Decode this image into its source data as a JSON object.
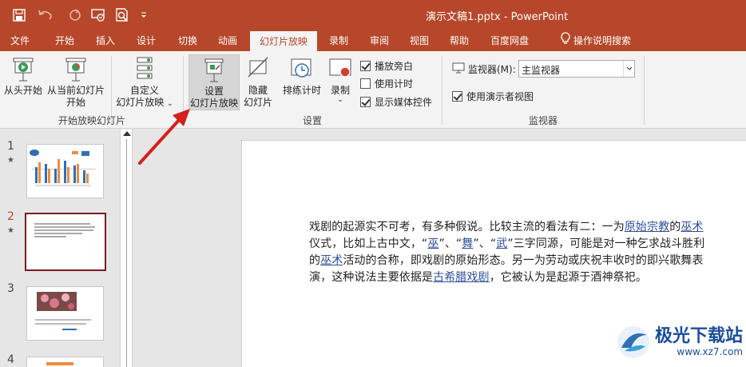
{
  "window": {
    "title": "演示文稿1.pptx  -  PowerPoint"
  },
  "qat": [
    {
      "name": "save-icon"
    },
    {
      "name": "undo-icon"
    },
    {
      "name": "redo-icon"
    },
    {
      "name": "presenter-icon"
    },
    {
      "name": "print-preview-icon"
    },
    {
      "name": "customize-qat-icon"
    }
  ],
  "tabs": [
    "文件",
    "开始",
    "插入",
    "设计",
    "切换",
    "动画",
    "幻灯片放映",
    "录制",
    "审阅",
    "视图",
    "帮助",
    "百度网盘"
  ],
  "active_tab": "幻灯片放映",
  "tell_me": "操作说明搜索",
  "ribbon": {
    "start_group": {
      "label": "开始放映幻灯片",
      "from_beginning": "从头开始",
      "from_current_1": "从当前幻灯片",
      "from_current_2": "开始",
      "custom_1": "自定义",
      "custom_2": "幻灯片放映"
    },
    "setup_group": {
      "label": "设置",
      "setup_1": "设置",
      "setup_2": "幻灯片放映",
      "hide_1": "隐藏",
      "hide_2": "幻灯片",
      "rehearse": "排练计时",
      "record": "录制",
      "play_narration": "播放旁白",
      "use_timings": "使用计时",
      "show_media": "显示媒体控件"
    },
    "monitor_group": {
      "label": "监视器",
      "monitor_label": "监视器(M):",
      "monitor_value": "主监视器",
      "presenter_view": "使用演示者视图"
    }
  },
  "checkboxes": {
    "play_narration": true,
    "use_timings": false,
    "show_media": true,
    "presenter_view": true
  },
  "slides": [
    {
      "number": "1",
      "star": "★"
    },
    {
      "number": "2",
      "star": "★"
    },
    {
      "number": "3",
      "star": ""
    },
    {
      "number": "4",
      "star": ""
    }
  ],
  "slide_content": {
    "p1": "戏剧的起源实不可考，有多种假说。比较主流的看法有二：一为",
    "l1": "原始宗教",
    "p2": "的",
    "l2": "巫术",
    "p3": "仪式，比如上古中文，“",
    "l3": "巫",
    "p4": "”、“",
    "l4": "舞",
    "p5": "”、“",
    "l5": "武",
    "p6": "”三字同源，可能是对一种乞求战斗胜利的",
    "l6": "巫术",
    "p7": "活动的合称，即戏剧的原始形态。另一为劳动或庆祝丰收时的即兴歌舞表演，这种说法主要依据是",
    "l7": "古希腊戏剧",
    "p8": "，它被认为是起源于酒神祭祀。"
  },
  "watermark": {
    "name": "极光下载站",
    "url": "www.xz7.com"
  },
  "colors": {
    "accent": "#b7472a",
    "link": "#2e4f9e",
    "selected_slide_border": "#7b1c20",
    "arrow": "#d4201e"
  }
}
